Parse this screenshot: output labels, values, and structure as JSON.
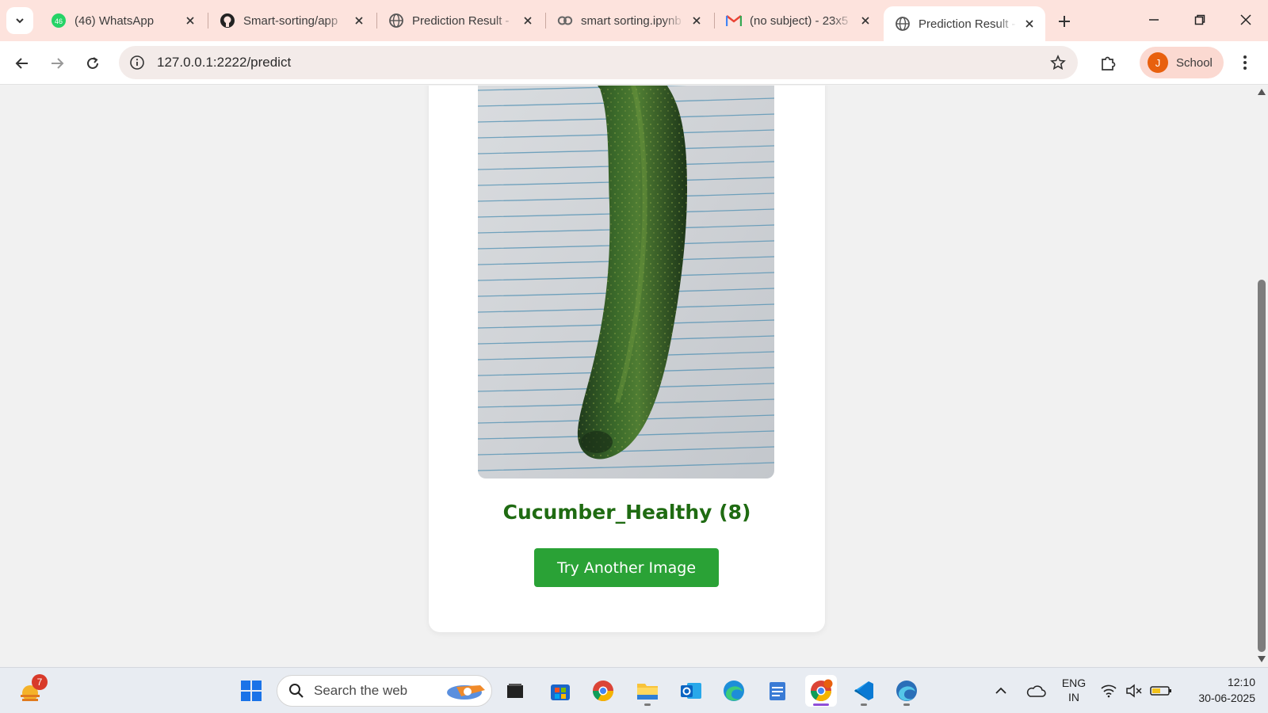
{
  "browser": {
    "tabs": [
      {
        "label": "(46) WhatsApp",
        "icon": "whatsapp-icon"
      },
      {
        "label": "Smart-sorting/app",
        "icon": "github-icon"
      },
      {
        "label": "Prediction Result -",
        "icon": "globe-icon"
      },
      {
        "label": "smart sorting.ipynb",
        "icon": "colab-icon"
      },
      {
        "label": "(no subject) - 23x5",
        "icon": "gmail-icon"
      },
      {
        "label": "Prediction Result -",
        "icon": "globe-icon",
        "active": true
      }
    ],
    "url": "127.0.0.1:2222/predict",
    "profile": {
      "initial": "J",
      "name": "School"
    }
  },
  "page": {
    "image_alt": "cucumber on lined paper",
    "result_label": "Cucumber_Healthy (8)",
    "try_again_label": "Try Another Image"
  },
  "taskbar": {
    "weather_badge": "7",
    "search_placeholder": "Search the web",
    "lang_line1": "ENG",
    "lang_line2": "IN",
    "time": "12:10",
    "date": "30-06-2025",
    "chrome_badge": "J"
  },
  "colors": {
    "accent_button": "#2aa236",
    "result_text": "#1f6b12",
    "tabstrip": "#fde3dd"
  }
}
